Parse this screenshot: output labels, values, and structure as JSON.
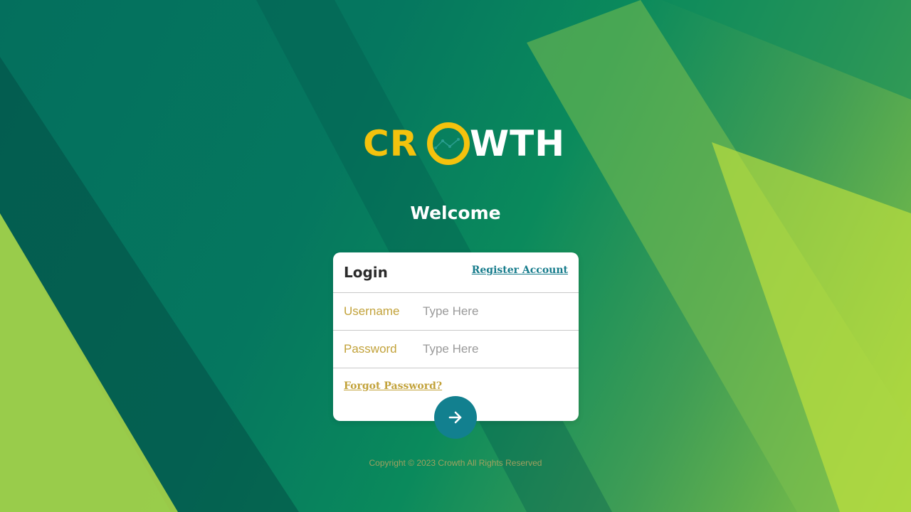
{
  "brand": {
    "logo_prefix": "CR",
    "logo_o": "O",
    "logo_suffix": "WTH",
    "primary_color": "#f4c20d",
    "accent_color": "#12808f"
  },
  "welcome": "Welcome",
  "login_card": {
    "title": "Login",
    "register_link": "Register Account",
    "username": {
      "label": "Username",
      "placeholder": "Type Here",
      "value": ""
    },
    "password": {
      "label": "Password",
      "placeholder": "Type Here",
      "value": ""
    },
    "forgot_link": "Forgot Password?",
    "submit_icon": "arrow-right-icon"
  },
  "footer": {
    "copyright": "Copyright © 2023 Crowth All Rights Reserved"
  }
}
